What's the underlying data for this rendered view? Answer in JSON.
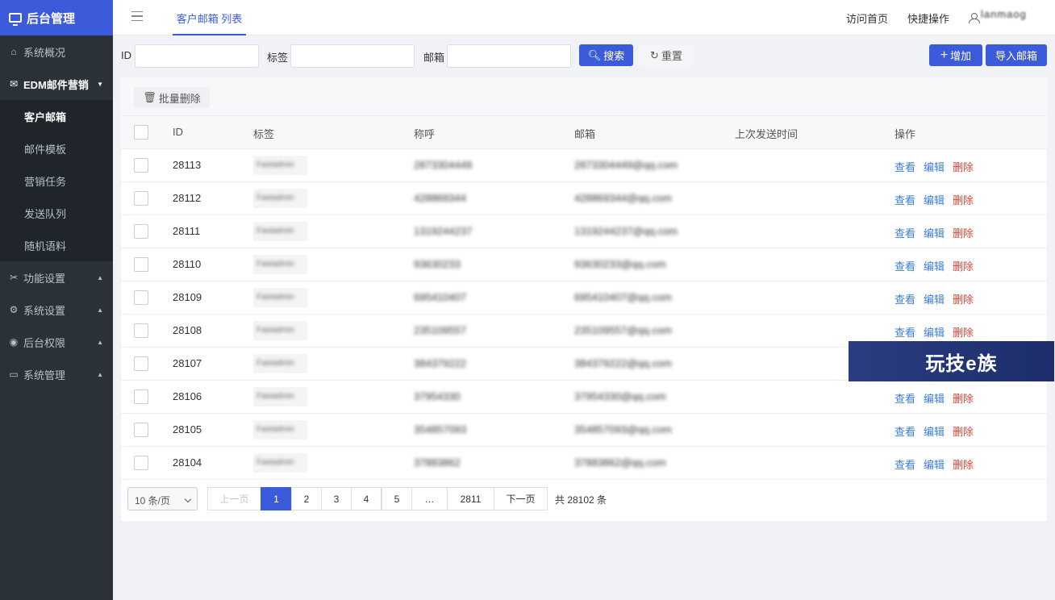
{
  "sidebar": {
    "title": "后台管理",
    "items": [
      {
        "icon": "home-icon",
        "label": "系统概况"
      },
      {
        "icon": "mail-icon",
        "label": "EDM邮件营销"
      },
      {
        "icon": "tools-icon",
        "label": "功能设置"
      },
      {
        "icon": "gear-icon",
        "label": "系统设置"
      },
      {
        "icon": "user-circle-icon",
        "label": "后台权限"
      },
      {
        "icon": "terminal-icon",
        "label": "系统管理"
      }
    ],
    "submenu": [
      "客户邮箱",
      "邮件模板",
      "营销任务",
      "发送队列",
      "随机语料"
    ]
  },
  "topbar": {
    "tab": "客户邮箱 列表",
    "visit_home": "访问首页",
    "quick_ops": "快捷操作",
    "username": "lanmaog"
  },
  "search": {
    "id_label": "ID",
    "tag_label": "标签",
    "email_label": "邮箱",
    "search_btn": "搜索",
    "reset_btn": "重置",
    "add_btn": "增加",
    "import_btn": "导入邮箱"
  },
  "toolbar": {
    "bulk_delete": "批量删除"
  },
  "table": {
    "headers": [
      "ID",
      "标签",
      "称呼",
      "邮箱",
      "上次发送时间",
      "操作"
    ],
    "actions": {
      "view": "查看",
      "edit": "编辑",
      "delete": "删除"
    },
    "rows": [
      {
        "id": "28113",
        "tag": "Fastadmin",
        "name": "2873304449",
        "email": "2873304449@qq.com",
        "last_sent": ""
      },
      {
        "id": "28112",
        "tag": "Fastadmin",
        "name": "428869344",
        "email": "428869344@qq.com",
        "last_sent": ""
      },
      {
        "id": "28111",
        "tag": "Fastadmin",
        "name": "1319244237",
        "email": "1319244237@qq.com",
        "last_sent": ""
      },
      {
        "id": "28110",
        "tag": "Fastadmin",
        "name": "93630233",
        "email": "93630233@qq.com",
        "last_sent": ""
      },
      {
        "id": "28109",
        "tag": "Fastadmin",
        "name": "695410407",
        "email": "695410407@qq.com",
        "last_sent": ""
      },
      {
        "id": "28108",
        "tag": "Fastadmin",
        "name": "235109557",
        "email": "235109557@qq.com",
        "last_sent": ""
      },
      {
        "id": "28107",
        "tag": "Fastadmin",
        "name": "384379222",
        "email": "384379222@qq.com",
        "last_sent": ""
      },
      {
        "id": "28106",
        "tag": "Fastadmin",
        "name": "37954330",
        "email": "37954330@qq.com",
        "last_sent": ""
      },
      {
        "id": "28105",
        "tag": "Fastadmin",
        "name": "354857093",
        "email": "354857093@qq.com",
        "last_sent": ""
      },
      {
        "id": "28104",
        "tag": "Fastadmin",
        "name": "37883862",
        "email": "37883862@qq.com",
        "last_sent": ""
      }
    ]
  },
  "pagination": {
    "page_size": "10 条/页",
    "prev": "上一页",
    "pages": [
      "1",
      "2",
      "3",
      "4",
      "5",
      "…",
      "2811"
    ],
    "current": "1",
    "next": "下一页",
    "total": "共 28102 条"
  },
  "watermark": "玩技e族",
  "colors": {
    "primary": "#3b5bdb",
    "sidebar": "#2a3138",
    "danger": "#e0463a",
    "link": "#3b7ddb"
  }
}
